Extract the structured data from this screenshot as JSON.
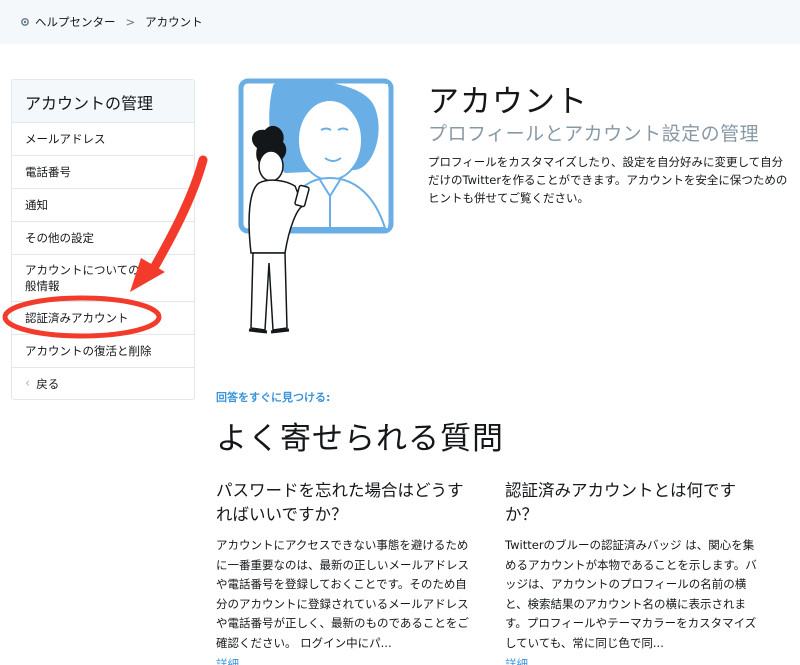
{
  "breadcrumb": {
    "home_icon": "home-icon",
    "help_center": "ヘルプセンター",
    "separator": ">",
    "current": "アカウント"
  },
  "sidebar": {
    "title": "アカウントの管理",
    "items": [
      {
        "label": "メールアドレス"
      },
      {
        "label": "電話番号"
      },
      {
        "label": "通知"
      },
      {
        "label": "その他の設定"
      },
      {
        "label": "アカウントについての一般情報"
      },
      {
        "label": "認証済みアカウント"
      },
      {
        "label": "アカウントの復活と削除"
      }
    ],
    "back_label": "戻る"
  },
  "hero": {
    "title": "アカウント",
    "subtitle": "プロフィールとアカウント設定の管理",
    "description": "プロフィールをカスタマイズしたり、設定を自分好みに変更して自分だけのTwitterを作ることができます。アカウントを安全に保つためのヒントも併せてご覧ください。"
  },
  "faq": {
    "kicker": "回答をすぐに見つける:",
    "title": "よく寄せられる質問",
    "items": [
      {
        "question": "パスワードを忘れた場合はどうすればいいですか？",
        "answer": "アカウントにアクセスできない事態を避けるために一番重要なのは、最新の正しいメールアドレスや電話番号を登録しておくことです。そのため自分のアカウントに登録されているメールアドレスや電話番号が正しく、最新のものであることをご確認ください。 ログイン中にパ...",
        "more": "詳細。"
      },
      {
        "question": "認証済みアカウントとは何ですか？",
        "answer": "Twitterのブルーの認証済みバッジ は、関心を集めるアカウントが本物であることを示します。バッジは、アカウントのプロフィールの名前の横と、検索結果のアカウント名の横に表示されます。プロフィールやテーマカラーをカスタマイズしていても、常に同じ色で同...",
        "more": "詳細。"
      }
    ]
  },
  "colors": {
    "accent_blue": "#3b94d9",
    "annotation_red": "#f23b2a",
    "illustration_blue": "#6aaee6"
  }
}
